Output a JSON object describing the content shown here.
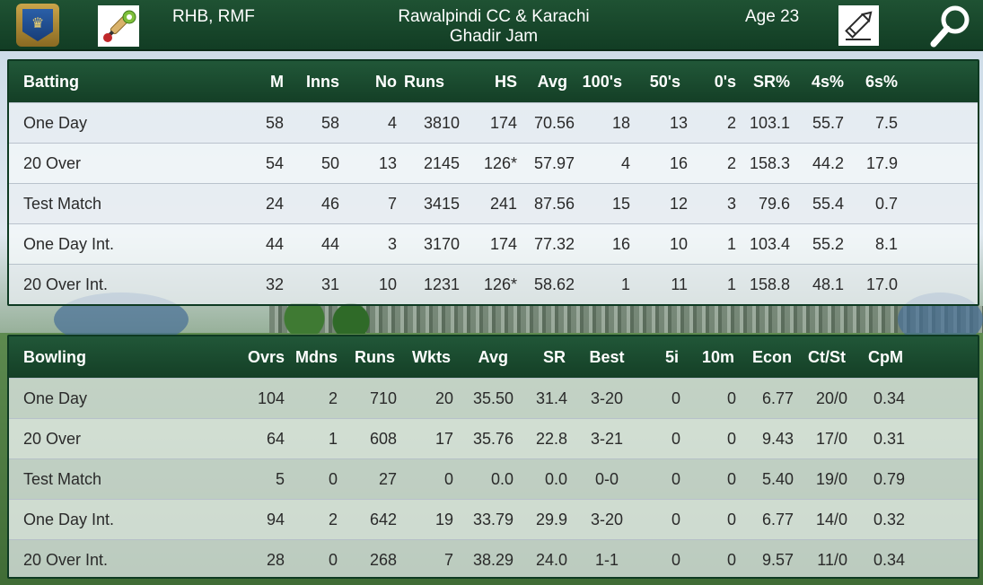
{
  "header": {
    "role": "RHB, RMF",
    "team_line1": "Rawalpindi CC & Karachi",
    "team_line2": "Ghadir Jam",
    "age": "Age 23",
    "icons": [
      "crest-icon",
      "cricket-bat-ball-icon",
      "pencil-edit-icon",
      "search-icon"
    ]
  },
  "batting": {
    "title": "Batting",
    "columns": [
      "M",
      "Inns",
      "No",
      "Runs",
      "HS",
      "Avg",
      "100's",
      "50's",
      "0's",
      "SR%",
      "4s%",
      "6s%"
    ],
    "rows": [
      {
        "label": "One Day",
        "values": [
          "58",
          "58",
          "4",
          "3810",
          "174",
          "70.56",
          "18",
          "13",
          "2",
          "103.1",
          "55.7",
          "7.5"
        ]
      },
      {
        "label": "20 Over",
        "values": [
          "54",
          "50",
          "13",
          "2145",
          "126*",
          "57.97",
          "4",
          "16",
          "2",
          "158.3",
          "44.2",
          "17.9"
        ]
      },
      {
        "label": "Test Match",
        "values": [
          "24",
          "46",
          "7",
          "3415",
          "241",
          "87.56",
          "15",
          "12",
          "3",
          "79.6",
          "55.4",
          "0.7"
        ]
      },
      {
        "label": "One Day Int.",
        "values": [
          "44",
          "44",
          "3",
          "3170",
          "174",
          "77.32",
          "16",
          "10",
          "1",
          "103.4",
          "55.2",
          "8.1"
        ]
      },
      {
        "label": "20 Over Int.",
        "values": [
          "32",
          "31",
          "10",
          "1231",
          "126*",
          "58.62",
          "1",
          "11",
          "1",
          "158.8",
          "48.1",
          "17.0"
        ]
      }
    ]
  },
  "bowling": {
    "title": "Bowling",
    "columns": [
      "Ovrs",
      "Mdns",
      "Runs",
      "Wkts",
      "Avg",
      "SR",
      "Best",
      "5i",
      "10m",
      "Econ",
      "Ct/St",
      "CpM"
    ],
    "rows": [
      {
        "label": "One Day",
        "values": [
          "104",
          "2",
          "710",
          "20",
          "35.50",
          "31.4",
          "3-20",
          "0",
          "0",
          "6.77",
          "20/0",
          "0.34"
        ]
      },
      {
        "label": "20 Over",
        "values": [
          "64",
          "1",
          "608",
          "17",
          "35.76",
          "22.8",
          "3-21",
          "0",
          "0",
          "9.43",
          "17/0",
          "0.31"
        ]
      },
      {
        "label": "Test Match",
        "values": [
          "5",
          "0",
          "27",
          "0",
          "0.0",
          "0.0",
          "0-0",
          "0",
          "0",
          "5.40",
          "19/0",
          "0.79"
        ]
      },
      {
        "label": "One Day Int.",
        "values": [
          "94",
          "2",
          "642",
          "19",
          "33.79",
          "29.9",
          "3-20",
          "0",
          "0",
          "6.77",
          "14/0",
          "0.32"
        ]
      },
      {
        "label": "20 Over Int.",
        "values": [
          "28",
          "0",
          "268",
          "7",
          "38.29",
          "24.0",
          "1-1",
          "0",
          "0",
          "9.57",
          "11/0",
          "0.34"
        ]
      }
    ]
  },
  "colors": {
    "header_green": "#1f5233",
    "header_dark": "#123d24",
    "row_light": "#f5f8fa",
    "text_dark": "#2a2a2a"
  }
}
